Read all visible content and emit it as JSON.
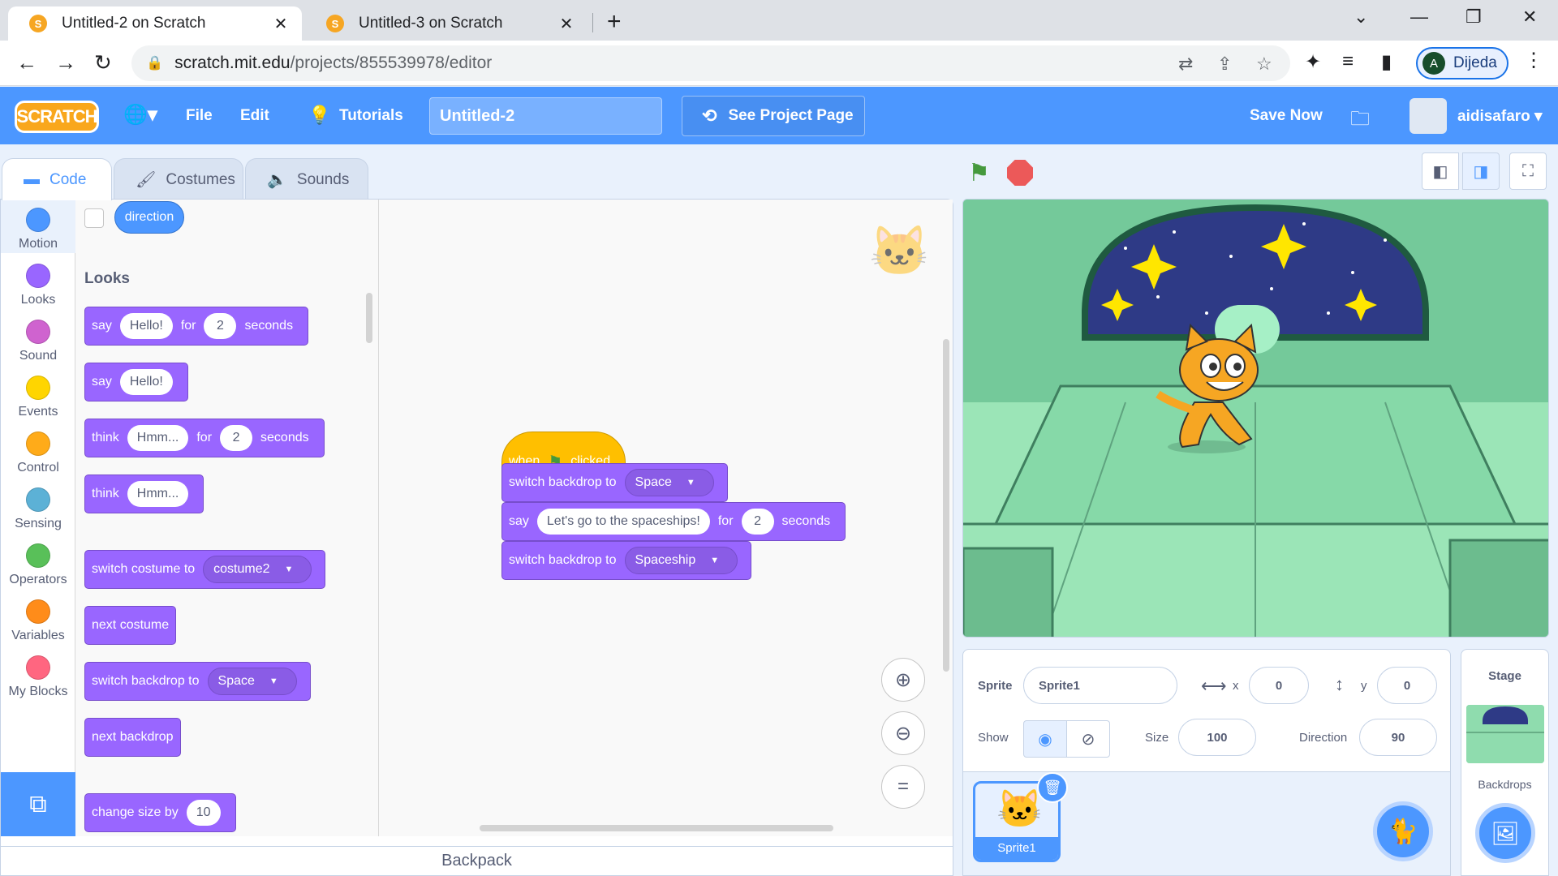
{
  "browser": {
    "tabs": [
      {
        "title": "Untitled-2 on Scratch",
        "favicon": "S"
      },
      {
        "title": "Untitled-3 on Scratch",
        "favicon": "S"
      }
    ],
    "url_domain": "scratch.mit.edu",
    "url_path": "/projects/855539978/editor",
    "profile_initial": "A",
    "profile_name": "Dijeda"
  },
  "menubar": {
    "logo": "SCRATCH",
    "file": "File",
    "edit": "Edit",
    "tutorials": "Tutorials",
    "project_title": "Untitled-2",
    "see_project": "See Project Page",
    "save_now": "Save Now",
    "username": "aidisafaro"
  },
  "editor_tabs": [
    "Code",
    "Costumes",
    "Sounds"
  ],
  "categories": [
    {
      "label": "Motion",
      "color": "#4c97ff"
    },
    {
      "label": "Looks",
      "color": "#9966ff"
    },
    {
      "label": "Sound",
      "color": "#cf63cf"
    },
    {
      "label": "Events",
      "color": "#ffd500"
    },
    {
      "label": "Control",
      "color": "#ffab19"
    },
    {
      "label": "Sensing",
      "color": "#5cb1d6"
    },
    {
      "label": "Operators",
      "color": "#59c059"
    },
    {
      "label": "Variables",
      "color": "#ff8c1a"
    },
    {
      "label": "My Blocks",
      "color": "#ff6680"
    }
  ],
  "palette": {
    "direction": "direction",
    "looks_header": "Looks",
    "say_for": {
      "say": "say",
      "msg": "Hello!",
      "for": "for",
      "secs": "2",
      "seconds": "seconds"
    },
    "say": {
      "say": "say",
      "msg": "Hello!"
    },
    "think_for": {
      "think": "think",
      "msg": "Hmm...",
      "for": "for",
      "secs": "2",
      "seconds": "seconds"
    },
    "think": {
      "think": "think",
      "msg": "Hmm..."
    },
    "switch_costume": {
      "label": "switch costume to",
      "value": "costume2"
    },
    "next_costume": "next costume",
    "switch_backdrop": {
      "label": "switch backdrop to",
      "value": "Space"
    },
    "next_backdrop": "next backdrop",
    "change_size": {
      "label": "change size by",
      "value": "10"
    }
  },
  "script": {
    "hat": {
      "when": "when",
      "clicked": "clicked"
    },
    "b1": {
      "label": "switch backdrop to",
      "value": "Space"
    },
    "b2": {
      "say": "say",
      "msg": "Let's go to the spaceships!",
      "for": "for",
      "secs": "2",
      "seconds": "seconds"
    },
    "b3": {
      "label": "switch backdrop to",
      "value": "Spaceship"
    }
  },
  "backpack": "Backpack",
  "sprite_info": {
    "sprite_label": "Sprite",
    "sprite_name": "Sprite1",
    "x_label": "x",
    "x": "0",
    "y_label": "y",
    "y": "0",
    "show_label": "Show",
    "size_label": "Size",
    "size": "100",
    "direction_label": "Direction",
    "direction": "90"
  },
  "sprite_tile": "Sprite1",
  "stage_panel": {
    "title": "Stage",
    "backdrops": "Backdrops"
  }
}
